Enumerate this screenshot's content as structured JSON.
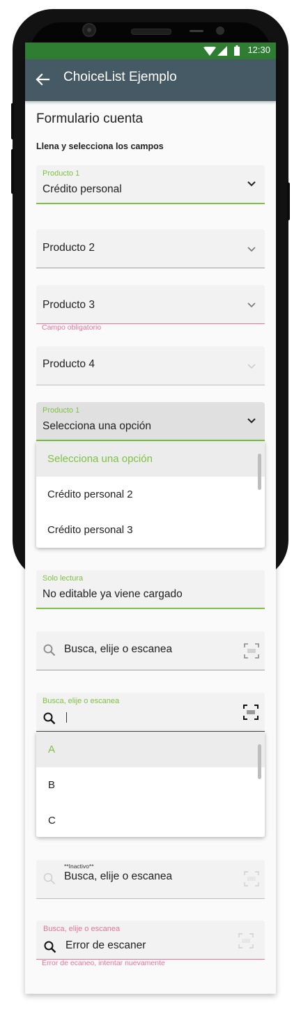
{
  "status_bar": {
    "time": "12:30"
  },
  "app_bar": {
    "title": "ChoiceList Ejemplo"
  },
  "form": {
    "title": "Formulario cuenta",
    "subtitle": "Llena y selecciona los campos"
  },
  "fields": {
    "producto1": {
      "label": "Producto 1",
      "value": "Crédito personal"
    },
    "producto2": {
      "text": "Producto 2"
    },
    "producto3": {
      "text": "Producto 3",
      "error": "Campo obligatorio"
    },
    "producto4": {
      "text": "Producto 4"
    },
    "producto1_open": {
      "label": "Producto 1",
      "value": "Selecciona una opción",
      "options": [
        "Selecciona una opción",
        "Crédito personal 2",
        "Crédito personal 3"
      ]
    },
    "solo_lectura": {
      "label": "Solo lectura",
      "value": "No editable ya viene cargado"
    },
    "busca1": {
      "placeholder": "Busca, elije o escanea"
    },
    "busca2": {
      "label": "Busca, elije o escanea",
      "options": [
        "A",
        "B",
        "C"
      ]
    },
    "inactivo": {
      "label": "**Inactivo**",
      "text": "Busca, elije o escanea"
    },
    "error_scan": {
      "label": "Busca, elije o escanea",
      "value": "Error de escaner",
      "error": "Error de ecaneo, intentar nuevamente"
    }
  },
  "colors": {
    "accent": "#7cc242",
    "error": "#e0769c",
    "status_bar": "#2e7d32",
    "app_bar": "#455a64"
  },
  "icons": [
    "back-arrow-icon",
    "wifi-icon",
    "signal-icon",
    "battery-icon",
    "chevron-down-icon",
    "search-icon",
    "barcode-scan-icon"
  ]
}
